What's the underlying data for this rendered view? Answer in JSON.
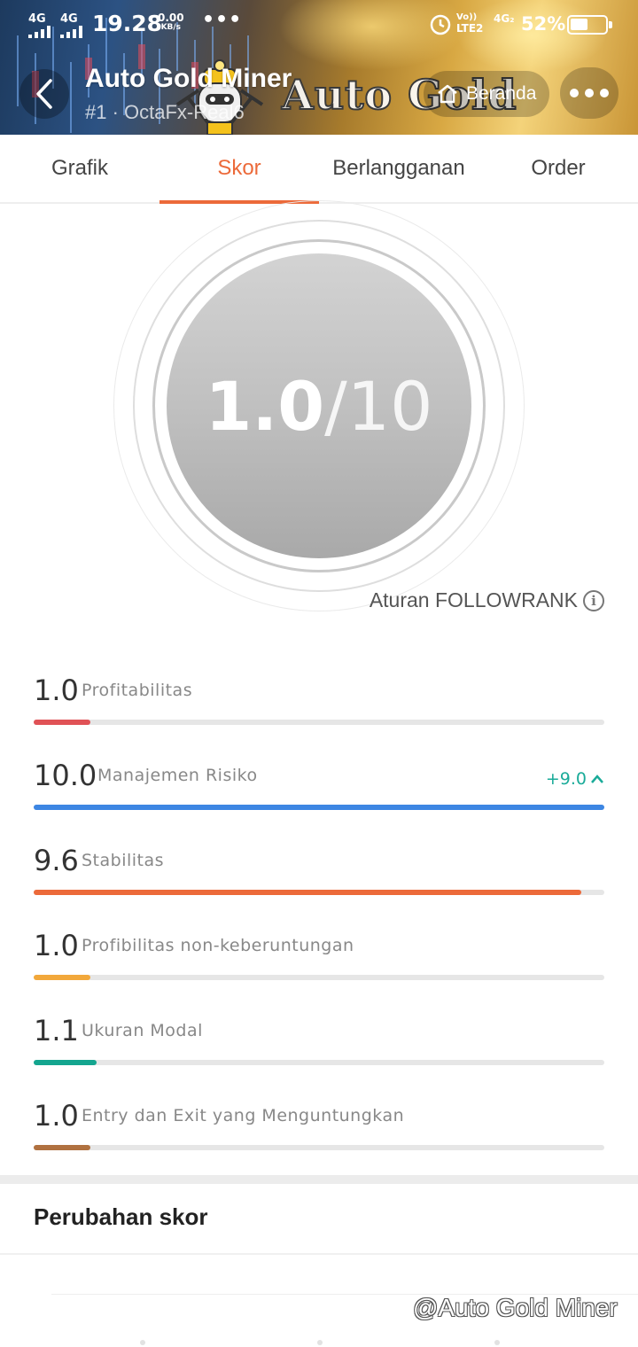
{
  "status_bar": {
    "network1": "4G",
    "network2": "4G",
    "time": "19.28",
    "speed_value": "0.00",
    "speed_unit": "KB/s",
    "dots": "•••",
    "volte_top": "Vo))",
    "volte_bottom": "LTE2",
    "network3": "4G₂",
    "battery_pct": "52%",
    "battery_level": 0.52
  },
  "header": {
    "title": "Auto Gold Miner",
    "subtitle": "#1 · OctaFx-Real6",
    "watermark": "Auto Gold",
    "home_label": "Beranda"
  },
  "tabs": [
    {
      "label": "Grafik"
    },
    {
      "label": "Skor"
    },
    {
      "label": "Berlangganan"
    },
    {
      "label": "Order"
    }
  ],
  "score": {
    "value": "1.0",
    "max": "/10",
    "rules_label": "Aturan FOLLOWRANK"
  },
  "metrics": [
    {
      "value": "1.0",
      "label": "Profitabilitas",
      "fraction": 0.1,
      "color": "#e05256"
    },
    {
      "value": "10.0",
      "label": "Manajemen Risiko",
      "fraction": 1.0,
      "color": "#3d86e3",
      "change": "+9.0"
    },
    {
      "value": "9.6",
      "label": "Stabilitas",
      "fraction": 0.96,
      "color": "#ec6a3a"
    },
    {
      "value": "1.0",
      "label": "Profibilitas non-keberuntungan",
      "fraction": 0.1,
      "color": "#f2a83b"
    },
    {
      "value": "1.1",
      "label": "Ukuran Modal",
      "fraction": 0.11,
      "color": "#14a58f"
    },
    {
      "value": "1.0",
      "label": "Entry dan Exit yang Menguntungkan",
      "fraction": 0.1,
      "color": "#b07140"
    }
  ],
  "score_history": {
    "title": "Perubahan skor"
  },
  "footer_watermark": "@Auto Gold Miner"
}
